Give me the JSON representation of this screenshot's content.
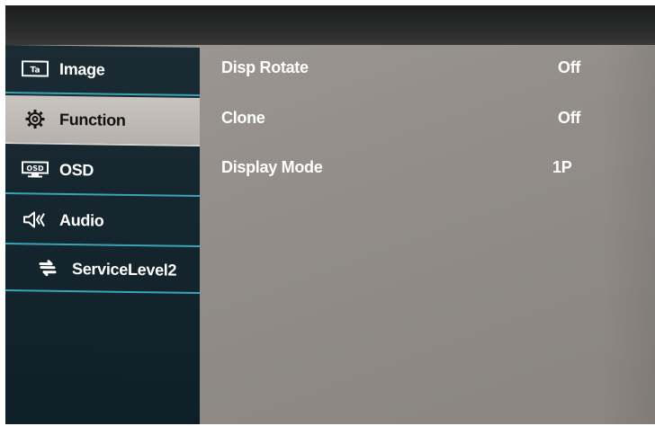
{
  "menu": {
    "items": [
      {
        "label": "Image",
        "icon": "image-icon"
      },
      {
        "label": "Function",
        "icon": "gear-icon"
      },
      {
        "label": "OSD",
        "icon": "osd-icon"
      },
      {
        "label": "Audio",
        "icon": "speaker-icon"
      },
      {
        "label": "ServiceLevel2",
        "icon": "service-icon"
      }
    ],
    "selected_index": 1
  },
  "settings": {
    "rows": [
      {
        "name": "Disp Rotate",
        "value": "Off"
      },
      {
        "name": "Clone",
        "value": "Off"
      },
      {
        "name": "Display Mode",
        "value": "1P"
      }
    ]
  },
  "colors": {
    "sidebar_bg": "#12232b",
    "accent_line": "#3aa4b6",
    "selected_bg": "#c2bdb8",
    "screen_bg": "#989390"
  }
}
